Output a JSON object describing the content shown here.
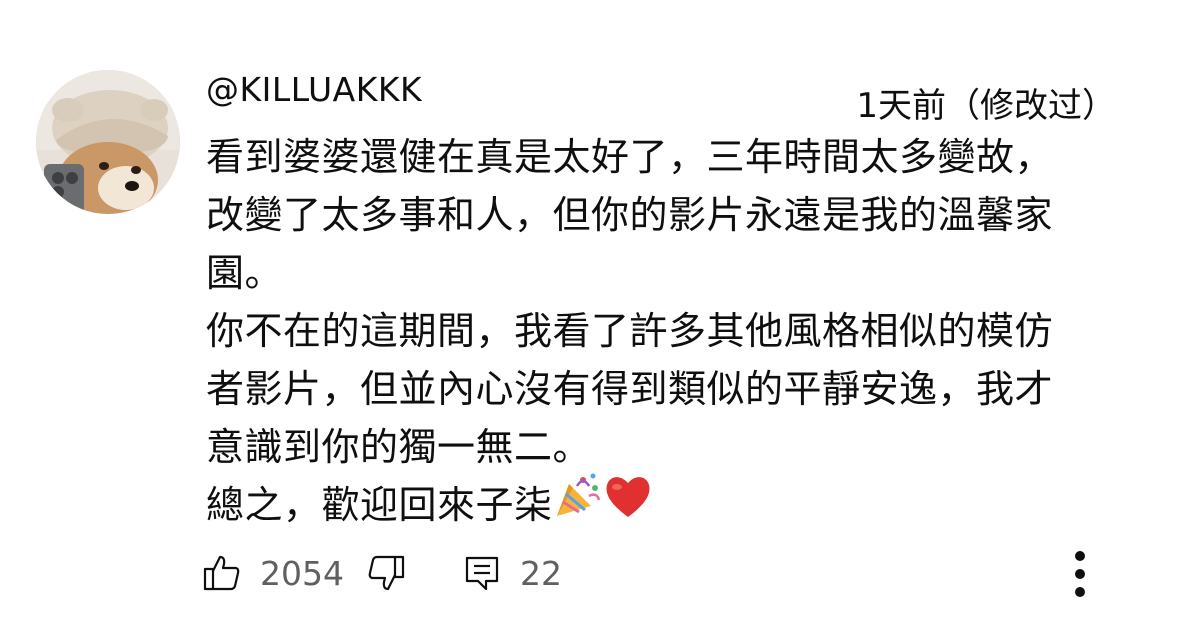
{
  "comment": {
    "author": "@KILLUAKKK",
    "timestamp": "1天前（修改过）",
    "lines": [
      "看到婆婆還健在真是太好了，三年時間太多變故，",
      "改變了太多事和人，但你的影片永遠是我的溫馨家",
      "園。",
      "你不在的這期間，我看了許多其他風格相似的模仿",
      "者影片，但並內心沒有得到類似的平靜安逸，我才",
      "意識到你的獨一無二。",
      "總之，歡迎回來子柒"
    ],
    "emojis": [
      "party-popper",
      "red-heart"
    ],
    "like_count": "2054",
    "reply_count": "22"
  },
  "icons": {
    "like": "thumbs-up-icon",
    "dislike": "thumbs-down-icon",
    "reply": "reply-comment-icon",
    "more": "more-vertical-icon"
  },
  "colors": {
    "text": "#0f0f0f",
    "secondary_text": "#606060",
    "heart": "#e0302f"
  }
}
